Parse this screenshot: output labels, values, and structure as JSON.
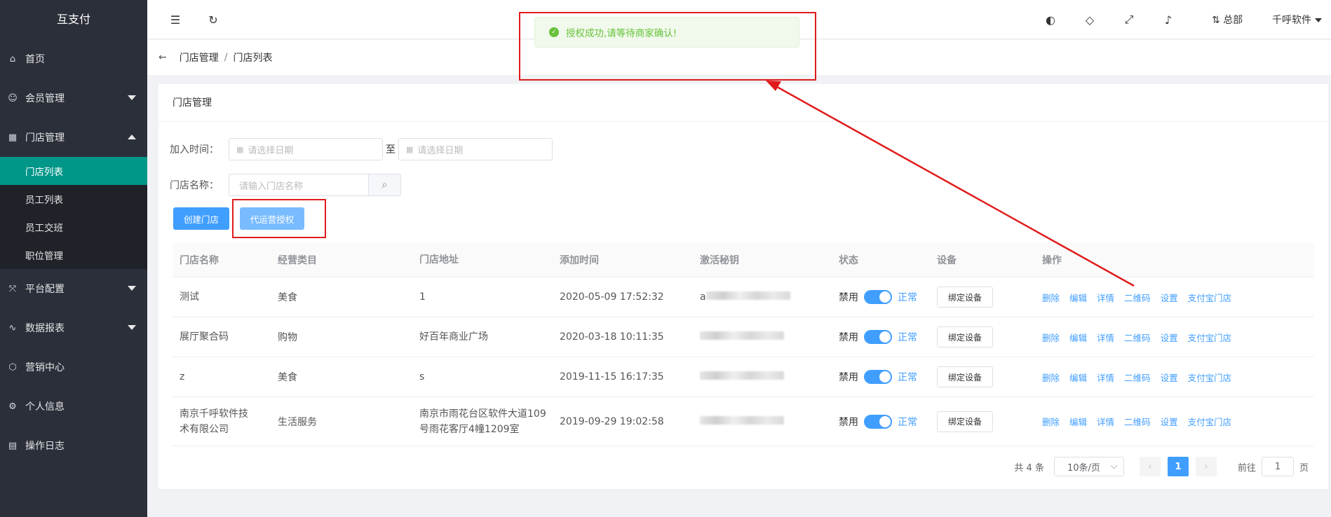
{
  "sidebar": {
    "brand": "互支付",
    "items": [
      {
        "label": "首页",
        "icon": "home-icon"
      },
      {
        "label": "会员管理",
        "icon": "member-icon"
      },
      {
        "label": "门店管理",
        "icon": "store-icon"
      },
      {
        "label": "平台配置",
        "icon": "config-icon"
      },
      {
        "label": "数据报表",
        "icon": "chart-icon"
      },
      {
        "label": "营销中心",
        "icon": "cube-icon"
      },
      {
        "label": "个人信息",
        "icon": "gear-icon"
      },
      {
        "label": "操作日志",
        "icon": "log-icon"
      }
    ],
    "sub_items": [
      {
        "label": "门店列表",
        "active": true
      },
      {
        "label": "员工列表",
        "active": false
      },
      {
        "label": "员工交班",
        "active": false
      },
      {
        "label": "职位管理",
        "active": false
      }
    ]
  },
  "header": {
    "branch": "总部",
    "user": "千呼软件"
  },
  "breadcrumb": {
    "level1": "门店管理",
    "sep": "/",
    "level2": "门店列表"
  },
  "toast": {
    "text": "授权成功,请等待商家确认!"
  },
  "card": {
    "title": "门店管理",
    "filters": {
      "join_time_label": "加入时间：",
      "date_placeholder": "请选择日期",
      "to": "至",
      "name_label": "门店名称：",
      "name_placeholder": "请输入门店名称"
    },
    "buttons": {
      "create": "创建门店",
      "authorize": "代运营授权"
    }
  },
  "table": {
    "headers": [
      "门店名称",
      "经营类目",
      "门店地址",
      "添加时间",
      "激活秘钥",
      "状态",
      "设备",
      "操作"
    ],
    "rows": [
      {
        "name": "测试",
        "category": "美食",
        "address": "1",
        "time": "2020-05-09 17:52:32",
        "key_prefix": "a",
        "status_off": "禁用",
        "status_on": "正常",
        "device": "绑定设备"
      },
      {
        "name": "展厅聚合码",
        "category": "购物",
        "address": "好百年商业广场",
        "time": "2020-03-18 10:11:35",
        "key_prefix": "",
        "status_off": "禁用",
        "status_on": "正常",
        "device": "绑定设备"
      },
      {
        "name": "z",
        "category": "美食",
        "address": "s",
        "time": "2019-11-15 16:17:35",
        "key_prefix": "",
        "status_off": "禁用",
        "status_on": "正常",
        "device": "绑定设备"
      },
      {
        "name": "南京千呼软件技术有限公司",
        "category": "生活服务",
        "address": "南京市雨花台区软件大道109号雨花客厅4幢1209室",
        "time": "2019-09-29 19:02:58",
        "key_prefix": "",
        "status_off": "禁用",
        "status_on": "正常",
        "device": "绑定设备"
      }
    ],
    "ops": [
      "删除",
      "编辑",
      "详情",
      "二维码",
      "设置",
      "支付宝门店"
    ]
  },
  "pagination": {
    "total": "共 4 条",
    "page_size": "10条/页",
    "current": "1",
    "goto": "前往",
    "goto_value": "1",
    "page_unit": "页"
  }
}
